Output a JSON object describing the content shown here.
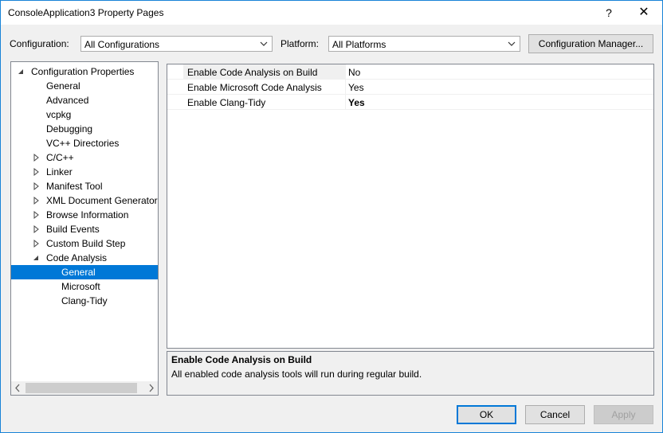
{
  "window": {
    "title": "ConsoleApplication3 Property Pages",
    "help_label": "?",
    "close_label": "✕"
  },
  "config": {
    "label": "Configuration:",
    "value": "All Configurations"
  },
  "platform": {
    "label": "Platform:",
    "value": "All Platforms"
  },
  "config_manager_label": "Configuration Manager...",
  "tree": {
    "items": [
      {
        "label": "Configuration Properties",
        "expander": "expanded"
      },
      {
        "label": "General",
        "expander": "none"
      },
      {
        "label": "Advanced",
        "expander": "none"
      },
      {
        "label": "vcpkg",
        "expander": "none"
      },
      {
        "label": "Debugging",
        "expander": "none"
      },
      {
        "label": "VC++ Directories",
        "expander": "none"
      },
      {
        "label": "C/C++",
        "expander": "collapsed"
      },
      {
        "label": "Linker",
        "expander": "collapsed"
      },
      {
        "label": "Manifest Tool",
        "expander": "collapsed"
      },
      {
        "label": "XML Document Generator",
        "expander": "collapsed"
      },
      {
        "label": "Browse Information",
        "expander": "collapsed"
      },
      {
        "label": "Build Events",
        "expander": "collapsed"
      },
      {
        "label": "Custom Build Step",
        "expander": "collapsed"
      },
      {
        "label": "Code Analysis",
        "expander": "expanded"
      },
      {
        "label": "General",
        "expander": "none",
        "selected": true
      },
      {
        "label": "Microsoft",
        "expander": "none"
      },
      {
        "label": "Clang-Tidy",
        "expander": "none"
      }
    ]
  },
  "properties": [
    {
      "name": "Enable Code Analysis on Build",
      "value": "No",
      "bold": false,
      "selected": true
    },
    {
      "name": "Enable Microsoft Code Analysis",
      "value": "Yes",
      "bold": false,
      "selected": false
    },
    {
      "name": "Enable Clang-Tidy",
      "value": "Yes",
      "bold": true,
      "selected": false
    }
  ],
  "description": {
    "title": "Enable Code Analysis on Build",
    "body": "All enabled code analysis tools will run during regular build."
  },
  "buttons": {
    "ok": "OK",
    "cancel": "Cancel",
    "apply": "Apply"
  },
  "colors": {
    "accent": "#0078d7",
    "border_blue": "#1883d7",
    "disabled_text": "#a0a0a0"
  }
}
